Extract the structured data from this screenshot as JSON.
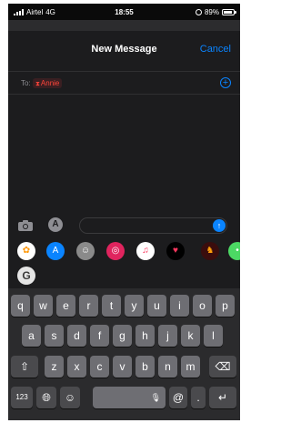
{
  "status_bar": {
    "carrier": "Airtel",
    "network": "4G",
    "time": "18:55",
    "battery": "89%",
    "battery_level": 0.89
  },
  "header": {
    "title": "New Message",
    "cancel_label": "Cancel"
  },
  "recipients": {
    "to_label": "To:",
    "chip_name": "Annie",
    "chip_icon": "warning-icon",
    "add_icon": "plus-circle-icon"
  },
  "input_bar": {
    "camera_icon": "camera-icon",
    "apps_icon": "app-store-icon",
    "message_value": "",
    "send_icon": "arrow-up-icon"
  },
  "app_drawer": [
    {
      "name": "photos",
      "icon": "photos-icon",
      "color": "#ffffff"
    },
    {
      "name": "app-store",
      "icon": "app-store-icon",
      "color": "#0a84ff"
    },
    {
      "name": "memoji",
      "icon": "memoji-icon",
      "color": "#8a8a8a"
    },
    {
      "name": "images-search",
      "icon": "search-globe-icon",
      "color": "#e0245e"
    },
    {
      "name": "music",
      "icon": "music-icon",
      "color": "#ffffff"
    },
    {
      "name": "digital-touch",
      "icon": "heart-icon",
      "color": "#000000"
    },
    {
      "name": "game",
      "icon": "game-icon",
      "color": "#3a0d0d"
    },
    {
      "name": "more",
      "icon": "more-icon",
      "color": "#4cd964"
    }
  ],
  "grammarly": {
    "icon": "grammarly-icon",
    "label": "G"
  },
  "keyboard": {
    "row1": [
      "q",
      "w",
      "e",
      "r",
      "t",
      "y",
      "u",
      "i",
      "o",
      "p"
    ],
    "row2": [
      "a",
      "s",
      "d",
      "f",
      "g",
      "h",
      "j",
      "k",
      "l"
    ],
    "row3": [
      "z",
      "x",
      "c",
      "v",
      "b",
      "n",
      "m"
    ],
    "numbers_label": "123",
    "at_label": "@",
    "period_label": ".",
    "shift_icon": "shift-icon",
    "delete_icon": "backspace-icon",
    "globe_icon": "globe-icon",
    "emoji_icon": "emoji-icon",
    "mic_icon": "microphone-icon",
    "return_icon": "return-icon"
  },
  "colors": {
    "accent": "#0a84ff",
    "background": "#1c1c1e",
    "recipient_error": "#ff453a"
  }
}
